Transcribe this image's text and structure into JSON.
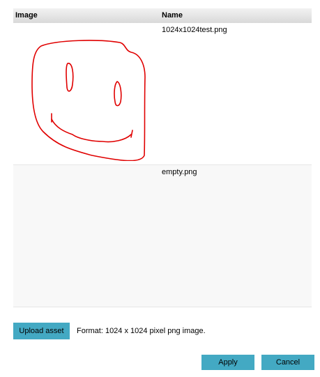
{
  "table": {
    "headers": {
      "image": "Image",
      "name": "Name"
    },
    "rows": [
      {
        "name": "1024x1024test.png",
        "thumbnail": "red-smiley-drawing"
      },
      {
        "name": "empty.png",
        "thumbnail": "empty"
      }
    ]
  },
  "footer": {
    "upload_label": "Upload asset",
    "format_text": "Format: 1024 x 1024 pixel png image."
  },
  "actions": {
    "apply_label": "Apply",
    "cancel_label": "Cancel"
  },
  "colors": {
    "button_bg": "#43a9c3",
    "drawing_stroke": "#e00000",
    "header_bg": "#dedede",
    "alt_row_bg": "#f8f8f8"
  }
}
